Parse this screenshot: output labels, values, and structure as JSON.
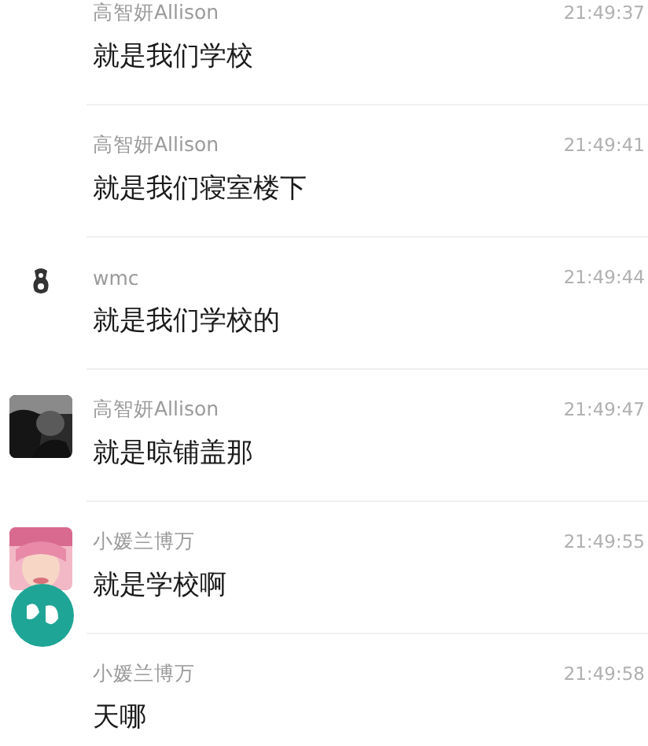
{
  "messages": [
    {
      "sender": "高智妍Allison",
      "time": "21:49:37",
      "text": "就是我们学校",
      "avatar": {
        "kind": "none"
      }
    },
    {
      "sender": "高智妍Allison",
      "time": "21:49:41",
      "text": "就是我们寝室楼下",
      "avatar": {
        "kind": "none"
      }
    },
    {
      "sender": "wmc",
      "time": "21:49:44",
      "text": "就是我们学校的",
      "avatar": {
        "kind": "icon"
      }
    },
    {
      "sender": "高智妍Allison",
      "time": "21:49:47",
      "text": "就是晾铺盖那"
    },
    {
      "sender": "小媛兰博万",
      "time": "21:49:55",
      "text": "就是学校啊",
      "avatar": {
        "kind": "photo_badge"
      }
    },
    {
      "sender": "小媛兰博万",
      "time": "21:49:58",
      "text": "天哪",
      "avatar": {
        "kind": "none"
      }
    }
  ]
}
